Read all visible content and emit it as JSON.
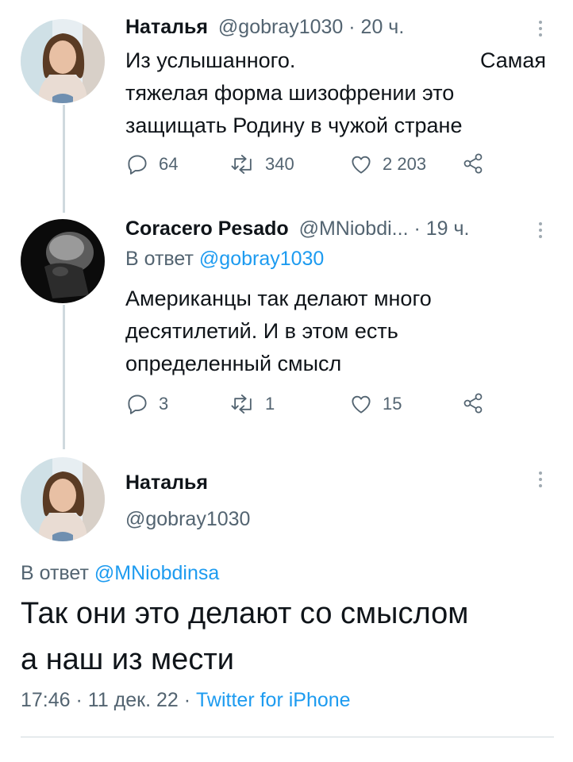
{
  "tweet1": {
    "display_name": "Наталья",
    "meta": "@gobray1030 · 20 ч.",
    "text_line1a": "Из услышанного.",
    "text_line1b": "Самая",
    "text_line2": "тяжелая форма шизофрении это",
    "text_line3": "защищать Родину в чужой стране",
    "replies": "64",
    "retweets": "340",
    "likes": "2 203"
  },
  "tweet2": {
    "display_name": "Coracero Pesado",
    "meta": "@MNiobdi... · 19 ч.",
    "reply_prefix": "В ответ",
    "reply_handle": "@gobray1030",
    "text_line1": "Американцы так делают много",
    "text_line2": "десятилетий. И в этом есть",
    "text_line3": "определенный смысл",
    "replies": "3",
    "retweets": "1",
    "likes": "15"
  },
  "tweet3": {
    "display_name": "Наталья",
    "handle": "@gobray1030",
    "reply_prefix": "В ответ",
    "reply_handle": "@MNiobdinsa",
    "text_line1": "Так они это делают со смыслом",
    "text_line2": "а наш из мести",
    "time_date": "17:46 · 11 дек. 22 ·",
    "source": "Twitter for iPhone"
  },
  "icons": {
    "reply": "reply-icon",
    "retweet": "retweet-icon",
    "like": "like-icon",
    "share": "share-icon",
    "more": "more-icon"
  },
  "colors": {
    "link": "#1d9bf0",
    "muted": "#536471",
    "thread_line": "#cfd9de"
  }
}
